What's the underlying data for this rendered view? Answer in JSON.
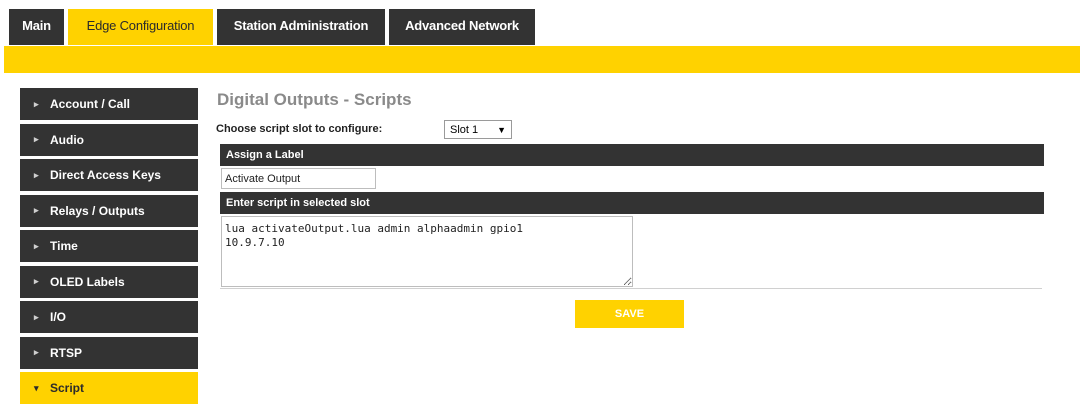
{
  "tabs": [
    {
      "label": "Main",
      "active": false
    },
    {
      "label": "Edge Configuration",
      "active": true
    },
    {
      "label": "Station Administration",
      "active": false
    },
    {
      "label": "Advanced Network",
      "active": false
    }
  ],
  "sidebar": {
    "items": [
      {
        "label": "Account / Call",
        "icon": "chevron-right-icon"
      },
      {
        "label": "Audio",
        "icon": "chevron-right-icon"
      },
      {
        "label": "Direct Access Keys",
        "icon": "chevron-right-icon"
      },
      {
        "label": "Relays / Outputs",
        "icon": "chevron-right-icon"
      },
      {
        "label": "Time",
        "icon": "chevron-right-icon"
      },
      {
        "label": "OLED Labels",
        "icon": "chevron-right-icon"
      },
      {
        "label": "I/O",
        "icon": "chevron-right-icon"
      },
      {
        "label": "RTSP",
        "icon": "chevron-right-icon"
      },
      {
        "label": "Script",
        "icon": "chevron-down-icon",
        "active": true
      }
    ]
  },
  "main": {
    "title": "Digital Outputs - Scripts",
    "choose_label": "Choose script slot to configure:",
    "slot_select": {
      "value": "Slot 1"
    },
    "label_bar": "Assign a Label",
    "label_value": "Activate Output",
    "script_bar": "Enter script in selected slot",
    "script_value": "lua activateOutput.lua admin alphaadmin gpio1\n10.9.7.10",
    "save_label": "SAVE"
  },
  "colors": {
    "accent": "#ffd200",
    "dark": "#333333",
    "title_gray": "#8a8a8a"
  }
}
